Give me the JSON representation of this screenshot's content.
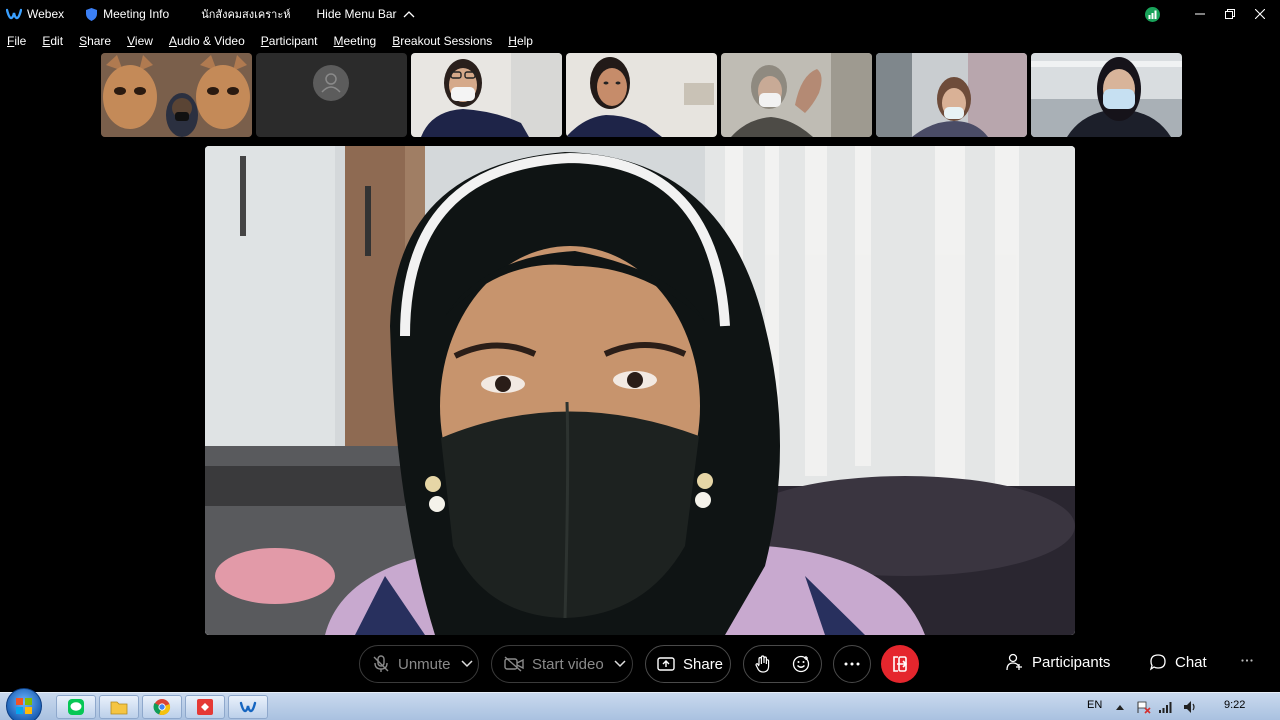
{
  "titlebar": {
    "app_name": "Webex",
    "meeting_info": "Meeting Info",
    "meeting_name": "นักสังคมสงเคราะห์",
    "hide_menu": "Hide Menu Bar"
  },
  "menu": {
    "items": [
      {
        "underline": "F",
        "rest": "ile"
      },
      {
        "underline": "E",
        "rest": "dit"
      },
      {
        "underline": "S",
        "rest": "hare"
      },
      {
        "underline": "V",
        "rest": "iew"
      },
      {
        "underline": "A",
        "rest": "udio & Video"
      },
      {
        "underline": "P",
        "rest": "articipant"
      },
      {
        "underline": "M",
        "rest": "eeting"
      },
      {
        "underline": "B",
        "rest": "reakout Sessions"
      },
      {
        "underline": "H",
        "rest": "elp"
      }
    ]
  },
  "controls": {
    "unmute": "Unmute",
    "start_video": "Start video",
    "share": "Share",
    "participants": "Participants",
    "chat": "Chat"
  },
  "taskbar": {
    "language": "EN",
    "time": "9:22"
  },
  "colors": {
    "leave": "#e5262d",
    "status": "#19a35a",
    "background": "#000000"
  }
}
